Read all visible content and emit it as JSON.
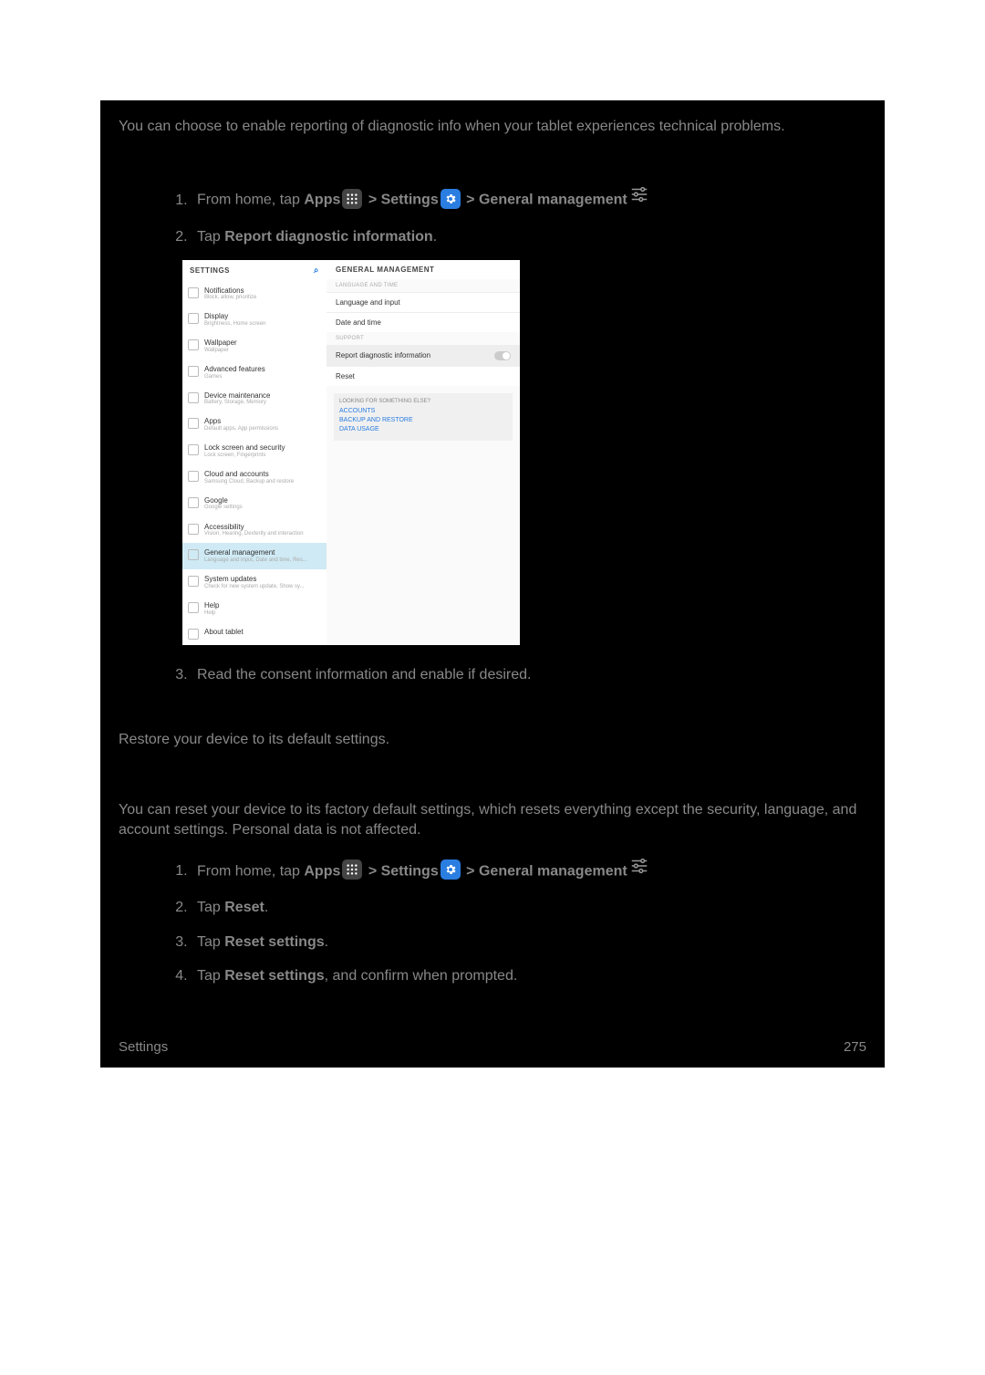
{
  "intro_para": "You can choose to enable reporting of diagnostic info when your tablet experiences technical problems.",
  "steps1": {
    "s1_pre": "From home, tap ",
    "s1_apps": "Apps",
    "s1_sep1": " > ",
    "s1_settings": "Settings",
    "s1_sep2": " > ",
    "s1_gm": "General management",
    "s2_pre": "Tap ",
    "s2_bold": "Report diagnostic information",
    "s2_post": ".",
    "s3": "Read the consent information and enable if desired."
  },
  "reset_intro": "Restore your device to its default settings.",
  "reset_para": "You can reset your device to its factory default settings, which resets everything except the security, language, and account settings. Personal data is not affected.",
  "steps2": {
    "s1_pre": "From home, tap ",
    "s1_apps": "Apps",
    "s1_sep1": " > ",
    "s1_settings": "Settings",
    "s1_sep2": " > ",
    "s1_gm": "General management",
    "s2_pre": "Tap ",
    "s2_bold": "Reset",
    "s2_post": ".",
    "s3_pre": "Tap ",
    "s3_bold": "Reset settings",
    "s3_post": ".",
    "s4_pre": "Tap ",
    "s4_bold": "Reset settings",
    "s4_post": ", and confirm when prompted."
  },
  "footer": {
    "left": "Settings",
    "right": "275"
  },
  "screenshot": {
    "left_header": "SETTINGS",
    "right_header": "GENERAL MANAGEMENT",
    "section_lang": "LANGUAGE AND TIME",
    "section_support": "SUPPORT",
    "row_lang": "Language and input",
    "row_date": "Date and time",
    "row_report": "Report diagnostic information",
    "row_reset": "Reset",
    "looking_label": "LOOKING FOR SOMETHING ELSE?",
    "link_accounts": "ACCOUNTS",
    "link_backup": "BACKUP AND RESTORE",
    "link_data": "DATA USAGE",
    "items": [
      {
        "t": "Notifications",
        "s": "Block, allow, prioritize"
      },
      {
        "t": "Display",
        "s": "Brightness, Home screen"
      },
      {
        "t": "Wallpaper",
        "s": "Wallpaper"
      },
      {
        "t": "Advanced features",
        "s": "Games"
      },
      {
        "t": "Device maintenance",
        "s": "Battery, Storage, Memory"
      },
      {
        "t": "Apps",
        "s": "Default apps, App permissions"
      },
      {
        "t": "Lock screen and security",
        "s": "Lock screen, Fingerprints"
      },
      {
        "t": "Cloud and accounts",
        "s": "Samsung Cloud, Backup and restore"
      },
      {
        "t": "Google",
        "s": "Google settings"
      },
      {
        "t": "Accessibility",
        "s": "Vision, Hearing, Dexterity and interaction"
      },
      {
        "t": "General management",
        "s": "Language and input, Date and time, Res..."
      },
      {
        "t": "System updates",
        "s": "Check for new system update, Show sy..."
      },
      {
        "t": "Help",
        "s": "Help"
      },
      {
        "t": "About tablet",
        "s": ""
      }
    ]
  }
}
